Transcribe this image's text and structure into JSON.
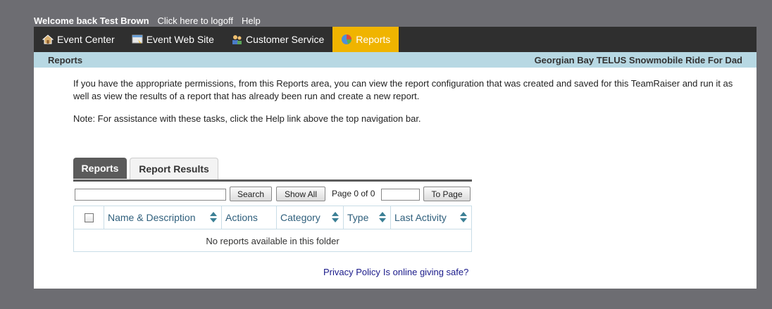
{
  "topbar": {
    "welcome": "Welcome back Test Brown",
    "logoff": "Click here to logoff",
    "help": "Help"
  },
  "nav": {
    "items": [
      {
        "label": "Event Center",
        "icon": "house-icon"
      },
      {
        "label": "Event Web Site",
        "icon": "website-icon"
      },
      {
        "label": "Customer Service",
        "icon": "people-icon"
      },
      {
        "label": "Reports",
        "icon": "pie-chart-icon",
        "active": true
      }
    ]
  },
  "pagebar": {
    "title": "Reports",
    "event": "Georgian Bay TELUS Snowmobile Ride For Dad"
  },
  "content": {
    "intro": "If you have the appropriate permissions, from this Reports area, you can view the report configuration that was created and saved for this TeamRaiser and run it as well as view the results of a report that has already been run and create a new report.",
    "note": "Note: For assistance with these tasks, click the Help link above the top navigation bar."
  },
  "tabs": {
    "reports": "Reports",
    "results": "Report Results"
  },
  "toolbar": {
    "search": "Search",
    "show_all": "Show All",
    "page_text": "Page 0 of 0",
    "to_page": "To Page"
  },
  "grid": {
    "columns": [
      "Name & Description",
      "Actions",
      "Category",
      "Type",
      "Last Activity"
    ],
    "empty": "No reports available in this folder"
  },
  "footer": {
    "privacy": "Privacy Policy",
    "safe": "Is online giving safe?"
  },
  "colors": {
    "nav_bg": "#2f2f2f",
    "active_tab": "#f0b400",
    "header_bar": "#b7d8e3"
  }
}
